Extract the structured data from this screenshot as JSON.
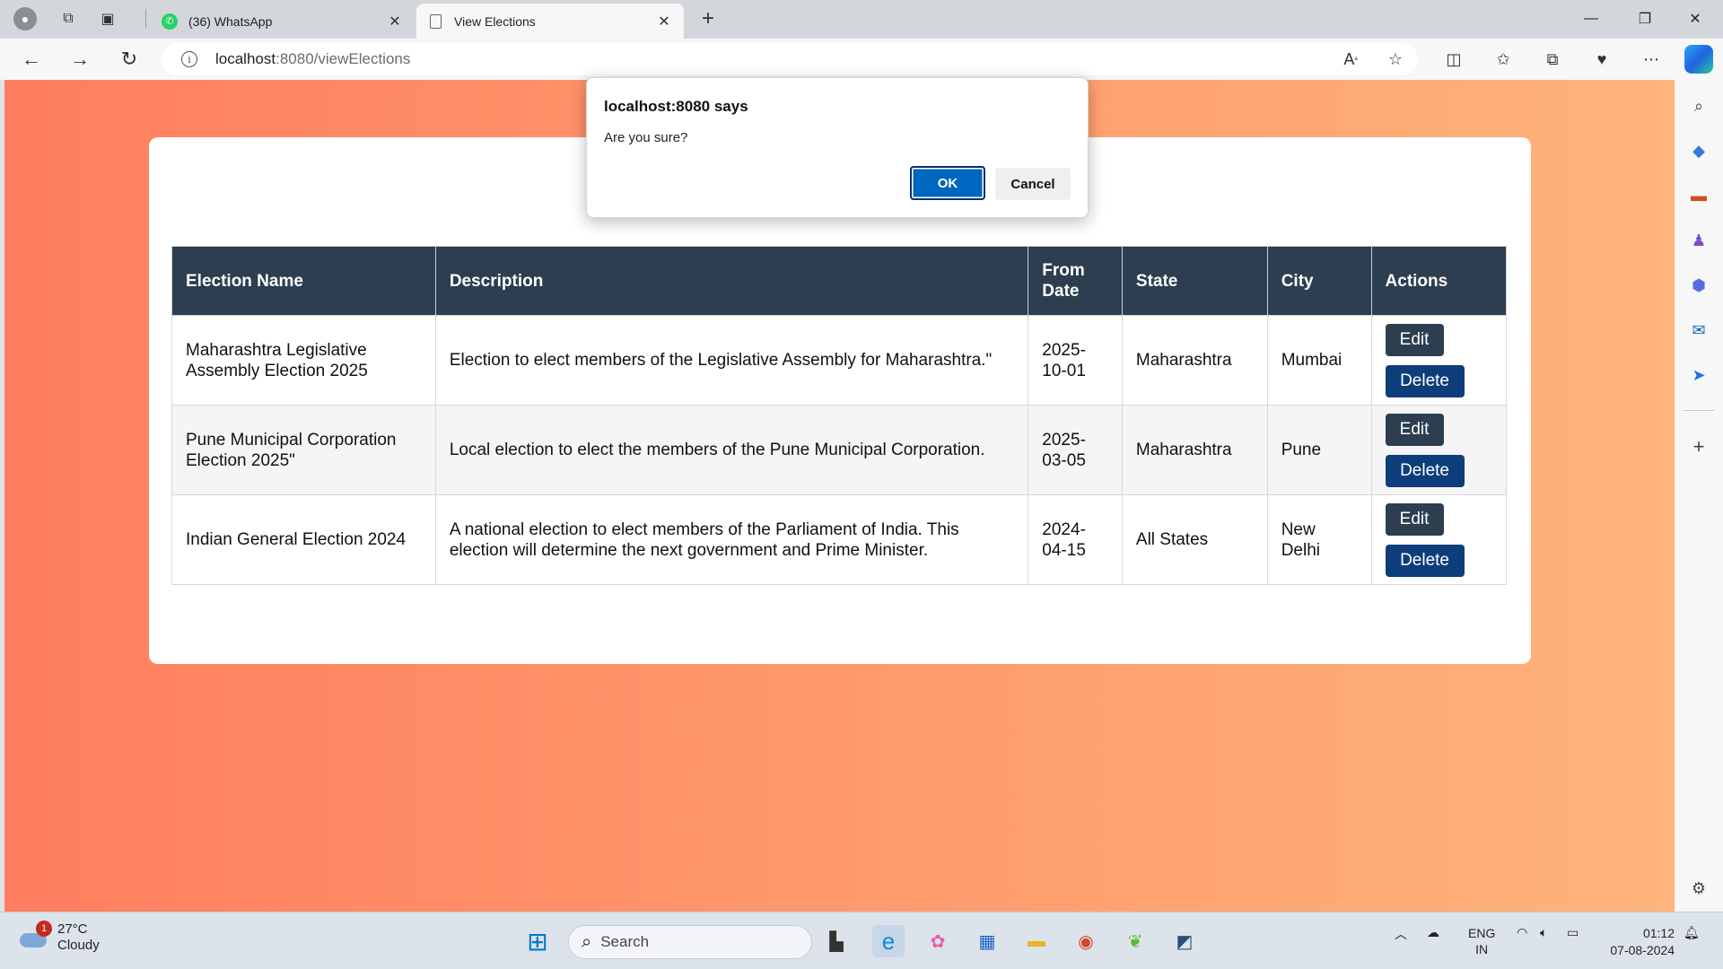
{
  "browser": {
    "tabs": [
      {
        "title": "(36) WhatsApp",
        "active": false,
        "icon": "whatsapp-icon"
      },
      {
        "title": "View Elections",
        "active": true,
        "icon": "page-icon"
      }
    ],
    "url_host": "localhost",
    "url_rest": ":8080/viewElections"
  },
  "table": {
    "headers": [
      "Election Name",
      "Description",
      "From Date",
      "State",
      "City",
      "Actions"
    ],
    "rows": [
      {
        "name": "Maharashtra Legislative Assembly Election 2025",
        "description": "Election to elect members of the Legislative Assembly for Maharashtra.\"",
        "from_date": "2025-10-01",
        "state": "Maharashtra",
        "city": "Mumbai"
      },
      {
        "name": "Pune Municipal Corporation Election 2025\"",
        "description": "Local election to elect the members of the Pune Municipal Corporation.",
        "from_date": "2025-03-05",
        "state": "Maharashtra",
        "city": "Pune"
      },
      {
        "name": "Indian General Election 2024",
        "description": "A national election to elect members of the Parliament of India. This election will determine the next government and Prime Minister.",
        "from_date": "2024-04-15",
        "state": "All States",
        "city": "New Delhi"
      }
    ],
    "edit_label": "Edit",
    "delete_label": "Delete"
  },
  "dialog": {
    "title": "localhost:8080 says",
    "message": "Are you sure?",
    "ok_label": "OK",
    "cancel_label": "Cancel"
  },
  "taskbar": {
    "weather_temp": "27°C",
    "weather_desc": "Cloudy",
    "weather_badge": "1",
    "search_placeholder": "Search",
    "lang_line1": "ENG",
    "lang_line2": "IN",
    "time": "01:12",
    "date": "07-08-2024"
  },
  "colors": {
    "gradient_start": "#ff7e5f",
    "gradient_end": "#feb47b",
    "header_bg": "#2c3e50",
    "delete_bg": "#0d3d7a",
    "ok_bg": "#0067c0"
  }
}
